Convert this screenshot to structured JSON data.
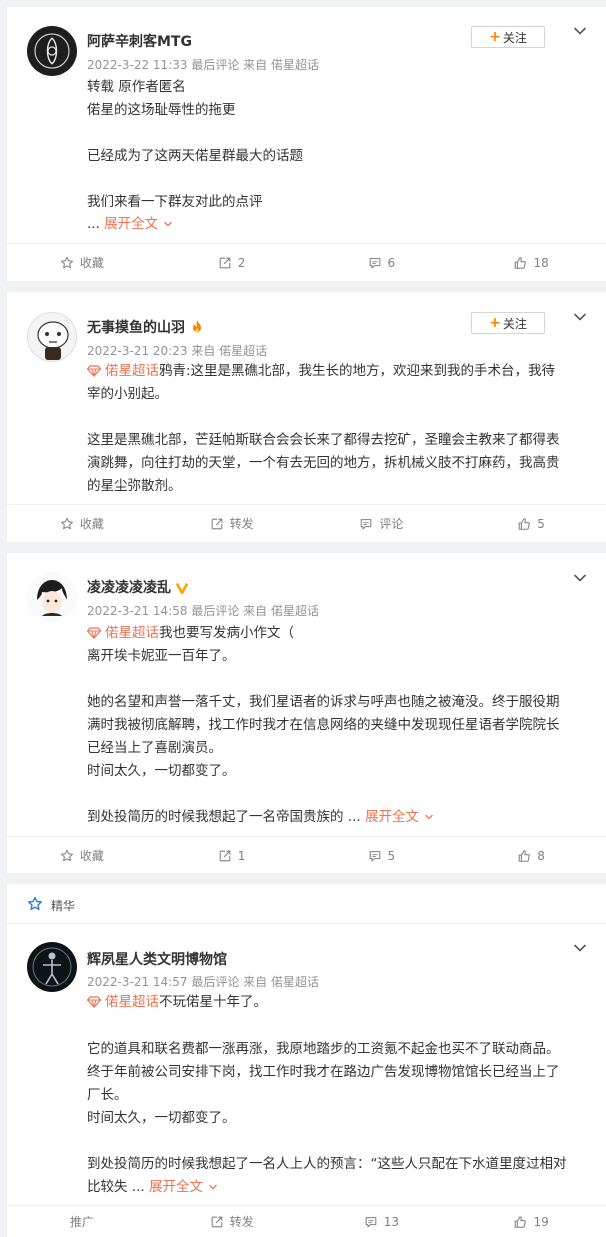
{
  "posts": [
    {
      "author": "阿萨辛刺客MTG",
      "meta": "2022-3-22 11:33 最后评论 来自 偌星超话",
      "follow_label": "关注",
      "lines": [
        "转载 原作者匿名",
        "偌星的这场耻辱性的拖更",
        "",
        "已经成为了这两天偌星群最大的话题",
        "",
        "我们来看一下群友对此的点评"
      ],
      "ellipsis": "...",
      "expand_label": "展开全文",
      "actions": {
        "favorite": "收藏",
        "repost": "2",
        "comment": "6",
        "like": "18"
      }
    },
    {
      "author": "无事摸鱼的山羽",
      "meta": "2022-3-21 20:23 来自 偌星超话",
      "follow_label": "关注",
      "topic": "偌星超话",
      "lines": [
        "鸦青:这里是黑礁北部，我生长的地方，欢迎来到我的手术台，我待",
        "宰的小别起。",
        "",
        "这里是黑礁北部，芒廷帕斯联合会会长来了都得去挖矿，圣瞳会主教来了都得表",
        "演跳舞，向往打劫的天堂，一个有去无回的地方，拆机械义肢不打麻药，我高贵",
        "的星尘弥散剂。"
      ],
      "actions": {
        "favorite": "收藏",
        "repost": "转发",
        "comment": "评论",
        "like": "5"
      }
    },
    {
      "author": "凌凌凌凌凌乱",
      "meta": "2022-3-21 14:58 最后评论 来自 偌星超话",
      "topic": "偌星超话",
      "lines": [
        "我也要写发病小作文（",
        "离开埃卡妮亚一百年了。",
        "",
        "她的名望和声誉一落千丈，我们星语者的诉求与呼声也随之被淹没。终于服役期",
        "满时我被彻底解聘，找工作时我才在信息网络的夹缝中发现现任星语者学院院长",
        "已经当上了喜剧演员。",
        "时间太久，一切都变了。",
        "",
        "到处投简历的时候我想起了一名帝国贵族的"
      ],
      "ellipsis": "...",
      "expand_label": "展开全文",
      "actions": {
        "favorite": "收藏",
        "repost": "1",
        "comment": "5",
        "like": "8"
      }
    },
    {
      "featured_label": "精华",
      "author": "辉夙星人类文明博物馆",
      "meta": "2022-3-21 14:57 最后评论 来自 偌星超话",
      "topic": "偌星超话",
      "lines": [
        "不玩偌星十年了。",
        "",
        "它的道具和联名费都一涨再涨，我原地踏步的工资氪不起金也买不了联动商品。",
        "终于年前被公司安排下岗，找工作时我才在路边广告发现博物馆馆长已经当上了",
        "厂长。",
        "时间太久，一切都变了。",
        "",
        "到处投简历的时候我想起了一名人上人的预言：“这些人只配在下水道里度过相对",
        "比较失"
      ],
      "ellipsis": "...",
      "expand_label": "展开全文",
      "actions": {
        "favorite": "推广",
        "repost": "转发",
        "comment": "13",
        "like": "19"
      }
    }
  ],
  "icons": {
    "favorite": "star-outline-icon",
    "repost": "share-arrow-icon",
    "comment": "chat-bubble-icon",
    "like": "thumbs-up-icon",
    "more": "chevron-down-icon",
    "topic": "diamond-icon",
    "featured": "star-icon"
  },
  "colors": {
    "accent": "#eb7350",
    "follow_plus": "#ff8200",
    "featured_star": "#2e7bcf",
    "verified": "#ffa500"
  }
}
